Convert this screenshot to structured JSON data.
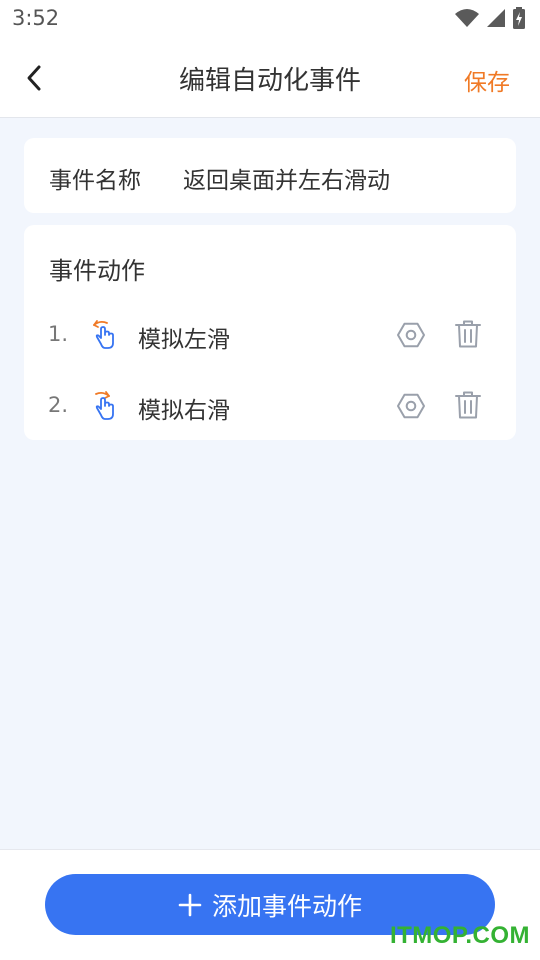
{
  "status_bar": {
    "time": "3:52",
    "icons": [
      "wifi-icon",
      "cellular-signal-icon",
      "battery-charging-icon"
    ]
  },
  "nav": {
    "back_icon": "chevron-left-icon",
    "title": "编辑自动化事件",
    "save_label": "保存",
    "save_color": "#f07a26"
  },
  "event_name": {
    "label": "事件名称",
    "value": "返回桌面并左右滑动"
  },
  "actions": {
    "title": "事件动作",
    "items": [
      {
        "index": "1.",
        "label": "模拟左滑",
        "icon": "swipe-left-hand-icon"
      },
      {
        "index": "2.",
        "label": "模拟右滑",
        "icon": "swipe-right-hand-icon"
      }
    ]
  },
  "bottom": {
    "add_label": "添加事件动作",
    "add_icon": "plus-icon",
    "accent_color": "#3774f2"
  },
  "watermark": "ITMOP.COM"
}
